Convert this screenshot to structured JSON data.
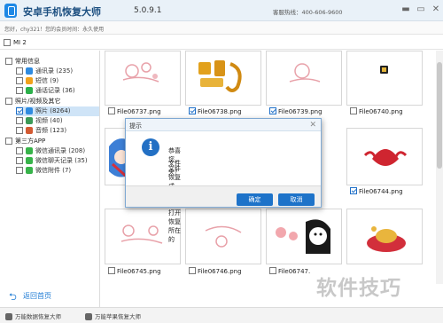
{
  "app": {
    "title": "安卓手机恢复大师",
    "version": "5.0.9.1",
    "hotline": "客服热线：400-606-9600",
    "greeting": "您好，chy321！您的会员时间：永久使用"
  },
  "device": {
    "label": "MI 2"
  },
  "sidebar": {
    "groups": [
      {
        "label": "常用信息"
      },
      {
        "label": "照片/视频及其它"
      },
      {
        "label": "第三方APP"
      }
    ],
    "items": [
      {
        "label": "通讯录 (235)",
        "icon": "contacts-icon"
      },
      {
        "label": "短信 (9)",
        "icon": "sms-icon"
      },
      {
        "label": "通话记录 (36)",
        "icon": "call-log-icon"
      },
      {
        "label": "照片 (8264)",
        "icon": "photo-icon"
      },
      {
        "label": "视频 (40)",
        "icon": "video-icon"
      },
      {
        "label": "音频 (123)",
        "icon": "audio-icon"
      },
      {
        "label": "微信通讯录 (208)",
        "icon": "wechat-contacts-icon"
      },
      {
        "label": "微信聊天记录 (35)",
        "icon": "wechat-chat-icon"
      },
      {
        "label": "微信附件 (7)",
        "icon": "wechat-attachment-icon"
      }
    ],
    "back_label": "返回首页"
  },
  "files": [
    {
      "name": "File06737.png",
      "checked": false
    },
    {
      "name": "File06738.png",
      "checked": true
    },
    {
      "name": "File06739.png",
      "checked": true
    },
    {
      "name": "File06740.png",
      "checked": false
    },
    {
      "name": "File06744.png",
      "checked": true
    },
    {
      "name": "File06745.png",
      "checked": false
    },
    {
      "name": "File06746.png",
      "checked": false
    },
    {
      "name": "File06747.",
      "checked": false
    }
  ],
  "dialog": {
    "title": "提示",
    "line1": "恭喜您，文件恢复成功！ 是否打开恢复所在的",
    "line2": "文件夹？",
    "ok": "确定",
    "cancel": "取消"
  },
  "bottom": {
    "item1": "万能数据恢复大师",
    "item2": "万能苹果恢复大师"
  },
  "watermark": "软件技巧",
  "colors": {
    "accent": "#1e73c9",
    "selected_row": "#cfe4f7"
  }
}
